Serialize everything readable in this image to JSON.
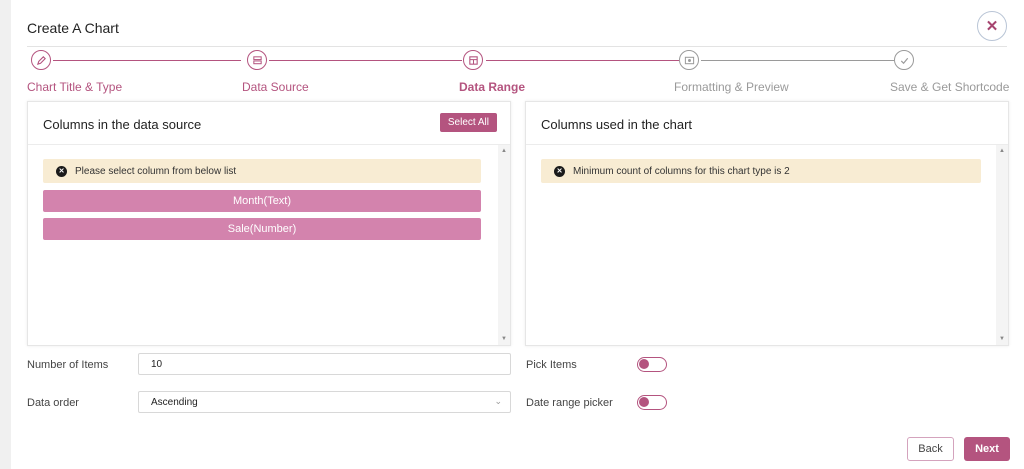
{
  "dialog": {
    "title": "Create A Chart",
    "close_icon": "close-icon"
  },
  "steps": [
    {
      "label": "Chart Title & Type",
      "icon": "pencil-icon",
      "state": "done"
    },
    {
      "label": "Data Source",
      "icon": "database-icon",
      "state": "done"
    },
    {
      "label": "Data Range",
      "icon": "table-icon",
      "state": "active"
    },
    {
      "label": "Formatting & Preview",
      "icon": "preview-icon",
      "state": "pending"
    },
    {
      "label": "Save & Get Shortcode",
      "icon": "check-icon",
      "state": "pending"
    }
  ],
  "left_panel": {
    "title": "Columns in the data source",
    "select_all": "Select All",
    "alert": "Please select column from below list",
    "columns": [
      "Month(Text)",
      "Sale(Number)"
    ]
  },
  "right_panel": {
    "title": "Columns used in the chart",
    "alert": "Minimum count of columns for this chart type is 2"
  },
  "form": {
    "number_of_items_label": "Number of Items",
    "number_of_items_value": "10",
    "data_order_label": "Data order",
    "data_order_value": "Ascending",
    "pick_items_label": "Pick Items",
    "pick_items_on": false,
    "date_range_label": "Date range picker",
    "date_range_on": false
  },
  "buttons": {
    "back": "Back",
    "next": "Next"
  },
  "colors": {
    "accent": "#b4547f",
    "accent_light": "#d383ad",
    "pending": "#9a9a9a",
    "alert_bg": "#f8ecd3"
  }
}
